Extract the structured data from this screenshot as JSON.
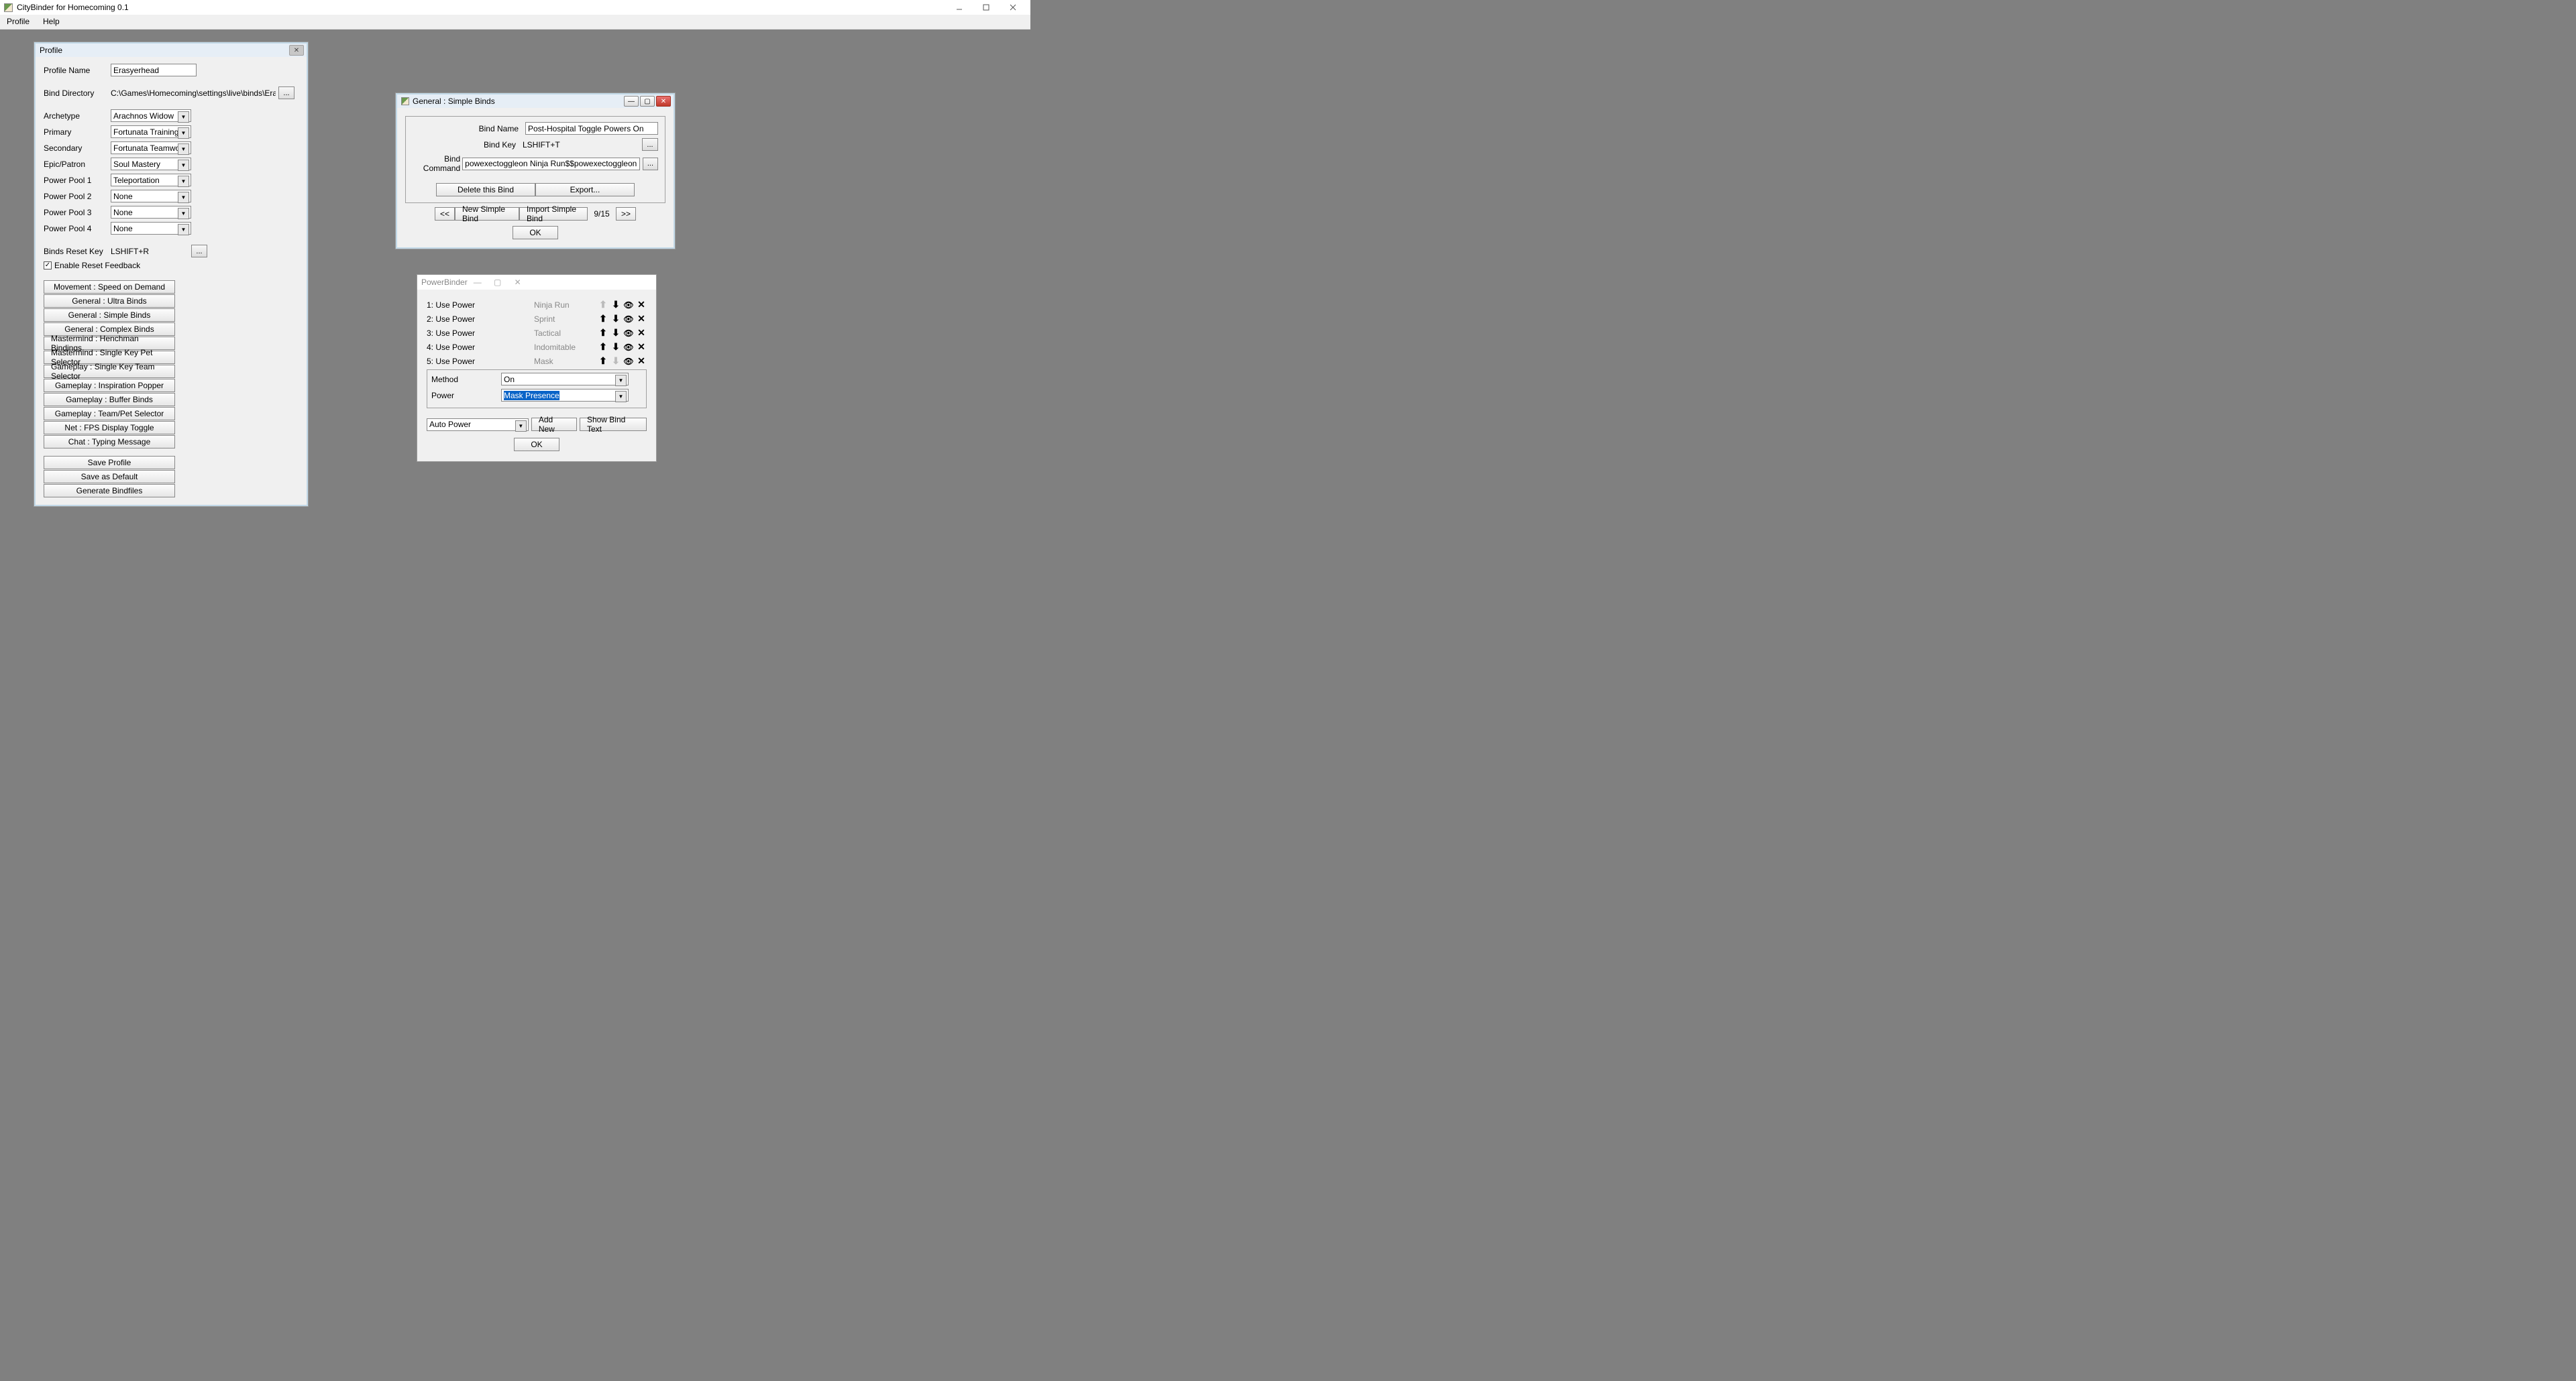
{
  "app": {
    "title": "CityBinder for Homecoming 0.1"
  },
  "menu": {
    "items": [
      "Profile",
      "Help"
    ]
  },
  "profile_panel": {
    "title": "Profile",
    "labels": {
      "profile_name": "Profile Name",
      "bind_directory": "Bind Directory",
      "archetype": "Archetype",
      "primary": "Primary",
      "secondary": "Secondary",
      "epic": "Epic/Patron",
      "pool1": "Power Pool 1",
      "pool2": "Power Pool 2",
      "pool3": "Power Pool 3",
      "pool4": "Power Pool 4",
      "reset_key": "Binds Reset Key",
      "enable_reset": "Enable Reset Feedback"
    },
    "values": {
      "profile_name": "Erasyerhead",
      "bind_directory": "C:\\Games\\Homecoming\\settings\\live\\binds\\Erasyer",
      "archetype": "Arachnos Widow",
      "primary": "Fortunata Training",
      "secondary": "Fortunata Teamwork",
      "epic": "Soul Mastery",
      "pool1": "Teleportation",
      "pool2": "None",
      "pool3": "None",
      "pool4": "None",
      "reset_key": "LSHIFT+R",
      "enable_reset_checked": "✓"
    },
    "dotdotdot": "...",
    "module_buttons": [
      "Movement : Speed on Demand",
      "General : Ultra Binds",
      "General : Simple Binds",
      "General : Complex Binds",
      "Mastermind : Henchman Bindings",
      "Mastermind : Single Key Pet Selector",
      "Gameplay : Single Key Team Selector",
      "Gameplay : Inspiration Popper",
      "Gameplay : Buffer Binds",
      "Gameplay : Team/Pet Selector",
      "Net : FPS Display Toggle",
      "Chat : Typing Message"
    ],
    "action_buttons": [
      "Save Profile",
      "Save as Default",
      "Generate Bindfiles"
    ]
  },
  "simple_binds": {
    "title": "General : Simple Binds",
    "labels": {
      "bind_name": "Bind Name",
      "bind_key": "Bind Key",
      "bind_command": "Bind Command"
    },
    "values": {
      "bind_name": "Post-Hospital Toggle Powers On",
      "bind_key": "LSHIFT+T",
      "bind_command": "powexectoggleon Ninja Run$$powexectoggleon Sprint$:",
      "counter": "9/15"
    },
    "buttons": {
      "delete": "Delete this Bind",
      "export": "Export...",
      "prev": "<<",
      "new": "New Simple Bind",
      "import": "Import Simple Bind",
      "next": ">>",
      "ok": "OK",
      "dots": "..."
    }
  },
  "powerbinder": {
    "title": "PowerBinder",
    "rows": [
      {
        "label": "1: Use Power",
        "value": "Ninja Run",
        "up_dim": true,
        "down_dim": false
      },
      {
        "label": "2: Use Power",
        "value": "Sprint",
        "up_dim": false,
        "down_dim": false
      },
      {
        "label": "3: Use Power",
        "value": "Tactical",
        "up_dim": false,
        "down_dim": false
      },
      {
        "label": "4: Use Power",
        "value": "Indomitable",
        "up_dim": false,
        "down_dim": false
      },
      {
        "label": "5: Use Power",
        "value": "Mask",
        "up_dim": false,
        "down_dim": true
      }
    ],
    "labels": {
      "method": "Method",
      "power": "Power"
    },
    "values": {
      "method": "On",
      "power": "Mask Presence",
      "action_select": "Auto Power"
    },
    "buttons": {
      "add_new": "Add New",
      "show_bind": "Show Bind Text",
      "ok": "OK"
    }
  }
}
